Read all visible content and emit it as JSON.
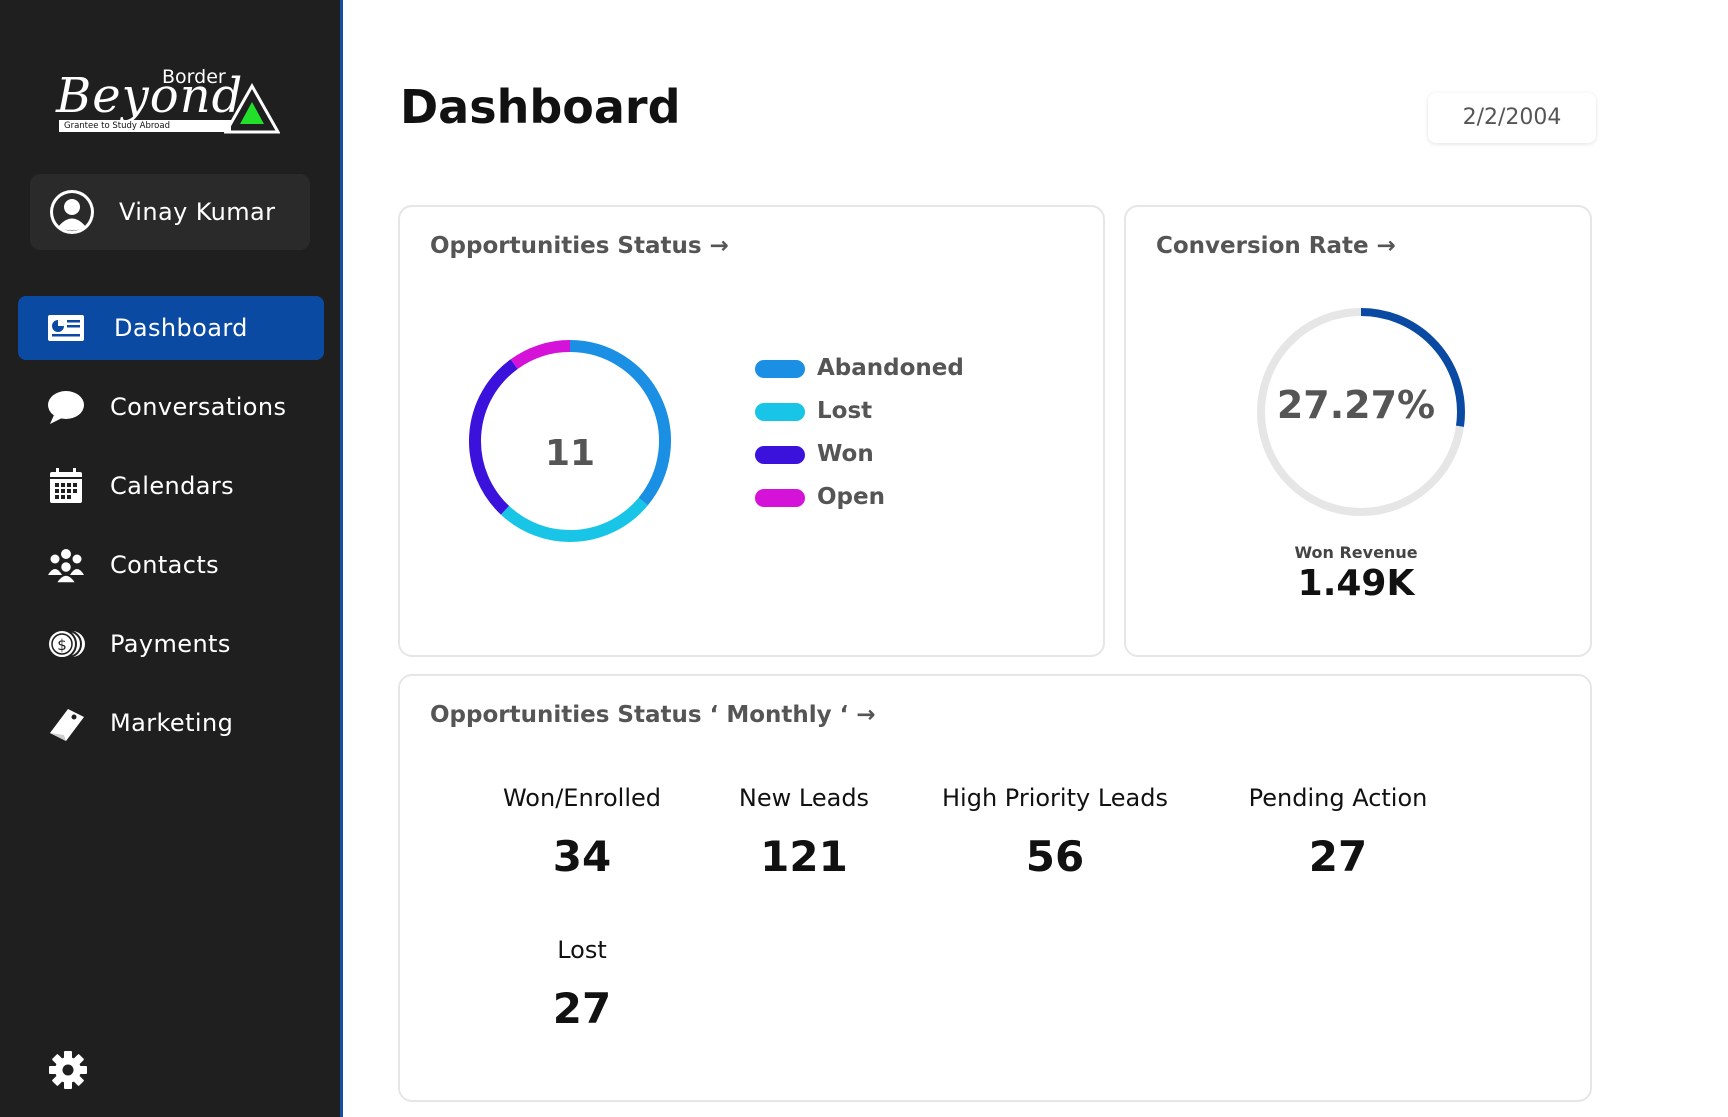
{
  "brand": {
    "top_word": "Border",
    "main_word": "Beyond",
    "tagline": "Grantee to Study Abroad"
  },
  "user": {
    "name": "Vinay Kumar"
  },
  "nav": {
    "items": [
      {
        "label": "Dashboard",
        "icon": "dashboard-icon",
        "active": true
      },
      {
        "label": "Conversations",
        "icon": "chat-bubble-icon"
      },
      {
        "label": "Calendars",
        "icon": "calendar-icon"
      },
      {
        "label": "Contacts",
        "icon": "contacts-icon"
      },
      {
        "label": "Payments",
        "icon": "payments-icon"
      },
      {
        "label": "Marketing",
        "icon": "marketing-tag-icon"
      }
    ],
    "settings_icon": "gear-icon"
  },
  "header": {
    "title": "Dashboard",
    "date": "2/2/2004"
  },
  "opportunities": {
    "title": "Opportunities Status →",
    "total": "11",
    "legend": [
      {
        "label": "Abandoned",
        "color": "#1a8fe3"
      },
      {
        "label": "Lost",
        "color": "#18c5e6"
      },
      {
        "label": "Won",
        "color": "#3a12dc"
      },
      {
        "label": "Open",
        "color": "#d412d8"
      }
    ]
  },
  "conversion": {
    "title": "Conversion Rate →",
    "rate": "27.27%",
    "rate_value": 0.2727,
    "revenue_label": "Won Revenue",
    "revenue_value": "1.49K",
    "track_color": "#e6e6e6",
    "fill_color": "#0b4aa3"
  },
  "monthly": {
    "title": "Opportunities Status ‘ Monthly ‘ →",
    "stats": [
      {
        "label": "Won/Enrolled",
        "value": "34"
      },
      {
        "label": "New Leads",
        "value": "121"
      },
      {
        "label": "High Priority Leads",
        "value": "56"
      },
      {
        "label": "Pending Action",
        "value": "27"
      },
      {
        "label": "Lost",
        "value": "27"
      }
    ]
  }
}
